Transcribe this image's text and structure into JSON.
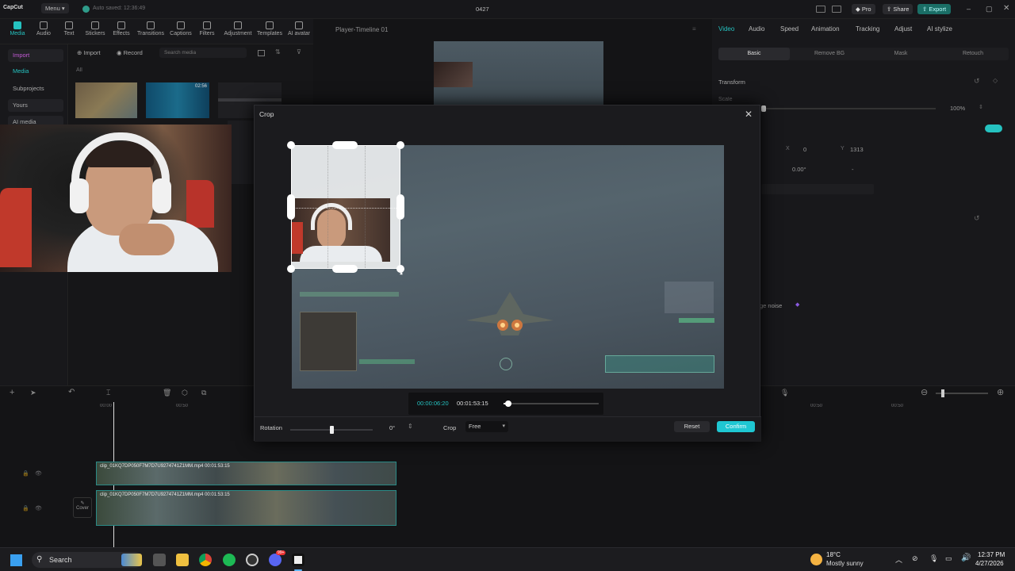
{
  "titlebar": {
    "app_name": "CapCut",
    "menu_label": "Menu",
    "autosave": "Auto saved: 12:36:49",
    "project_name": "0427",
    "pro_label": "Pro",
    "share_label": "Share",
    "export_label": "Export"
  },
  "toolbar": {
    "items": [
      "Media",
      "Audio",
      "Text",
      "Stickers",
      "Effects",
      "Transitions",
      "Captions",
      "Filters",
      "Adjustment",
      "Templates",
      "AI avatar"
    ]
  },
  "leftnav": {
    "items": [
      "Import",
      "Media",
      "Subprojects",
      "Yours",
      "AI media"
    ]
  },
  "media": {
    "import_label": "Import",
    "record_label": "Record",
    "search_placeholder": "Search media",
    "all_label": "All",
    "thumb_duration": "02:56"
  },
  "player": {
    "title": "Player-Timeline 01"
  },
  "right": {
    "tabs": [
      "Video",
      "Audio",
      "Speed",
      "Animation",
      "Tracking",
      "Adjust",
      "AI stylize"
    ],
    "subtabs": [
      "Basic",
      "Remove BG",
      "Mask",
      "Retouch"
    ],
    "transform_label": "Transform",
    "scale_label": "Scale",
    "scale_value": "100%",
    "x_label": "X",
    "x_value": "0",
    "y_label": "Y",
    "y_value": "1313",
    "rotate_value": "0.00°",
    "rotate_dash": "-",
    "noise_label": "ge noise"
  },
  "timeline": {
    "clip1_name": "clip_01KQ7DP050F7M7D7U9274741Z1MM.mp4  00:01:53:15",
    "clip2_name": "clip_01KQ7DP050F7M7D7U9274741Z1MM.mp4  00:01:53:15",
    "cover_label": "Cover",
    "ruler_start": "00:00",
    "ruler_mid": "00:50",
    "ruler_right1": "00:50",
    "ruler_right2": "00:50"
  },
  "crop_modal": {
    "title": "Crop",
    "current_time": "00:00:06:20",
    "total_time": "00:01:53:15",
    "scrub_fraction": 0.05,
    "rotation_label": "Rotation",
    "rotation_fraction": 0.5,
    "rotation_value": "0°",
    "crop_label": "Crop",
    "crop_option": "Free",
    "reset_label": "Reset",
    "confirm_label": "Confirm"
  },
  "taskbar": {
    "search_label": "Search",
    "weather_temp": "18°C",
    "weather_desc": "Mostly sunny",
    "time": "12:37 PM",
    "date": "4/27/2026",
    "discord_badge": "99+"
  },
  "colors": {
    "accent": "#25c2c0",
    "confirm_bg": "#1fc7d2",
    "timeline_clip_border": "#2a8a86",
    "hud_green": "#9ef0c8"
  }
}
